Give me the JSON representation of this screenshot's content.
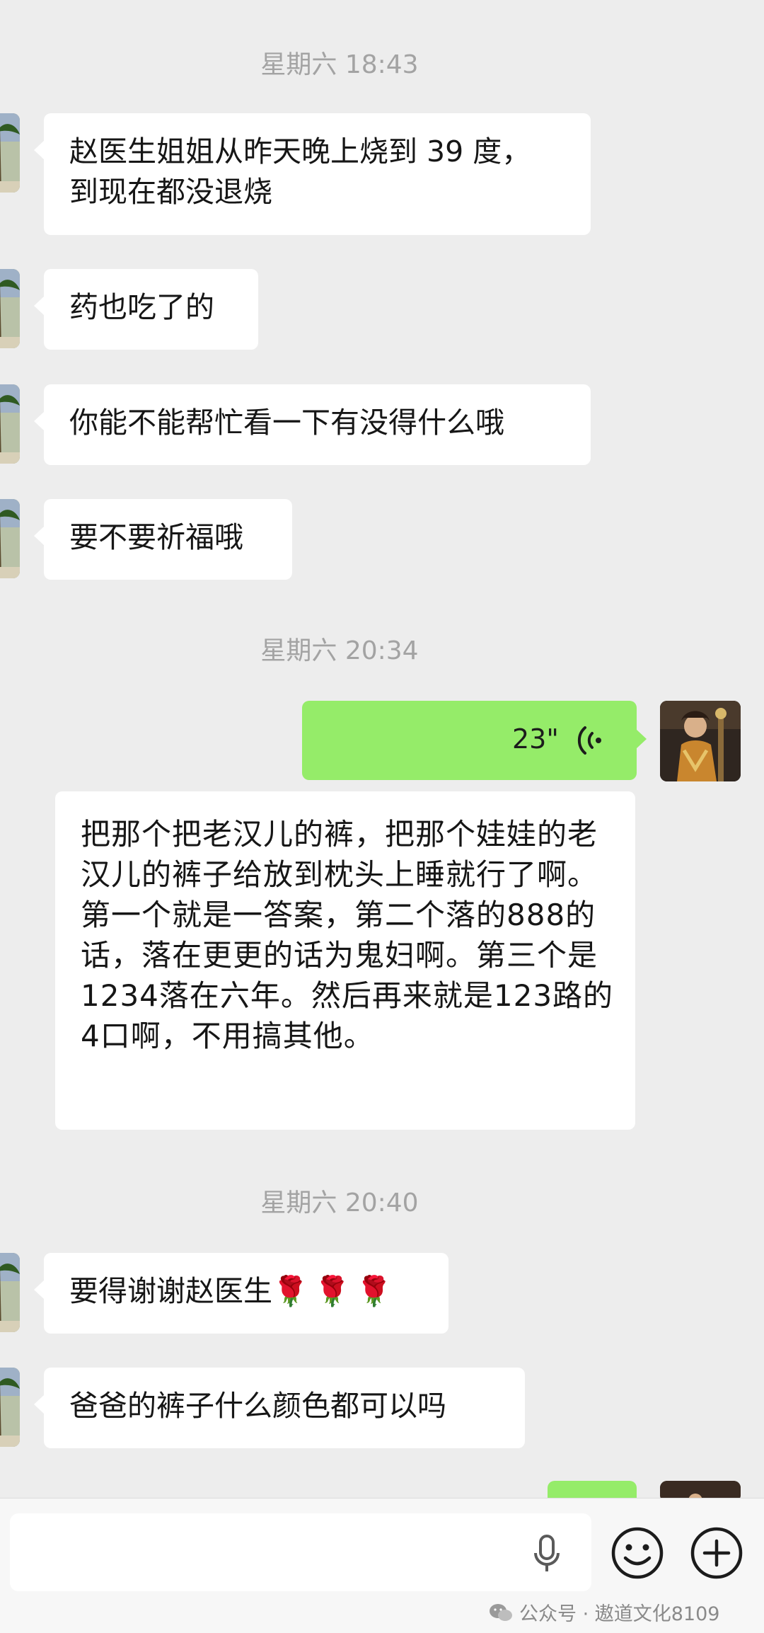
{
  "chat": {
    "timestamps": [
      "星期六 18:43",
      "星期六 20:34",
      "星期六 20:40"
    ],
    "messages_left_1": [
      "赵医生姐姐从昨天晚上烧到 39 度，\n到现在都没退烧",
      "药也吃了的",
      "你能不能帮忙看一下有没得什么哦",
      "要不要祈福哦"
    ],
    "voice": {
      "duration": "23\"",
      "transcript": "把那个把老汉儿的裤，把那个娃娃的老汉儿的裤子给放到枕头上睡就行了啊。第一个就是一答案，第二个落的888的话，落在更更的话为鬼妇啊。第三个是1234落在六年。然后再来就是123路的4口啊，不用搞其他。"
    },
    "messages_left_2": [
      {
        "text": "要得谢谢赵医生",
        "roses": "🌹🌹🌹"
      },
      {
        "text": "爸爸的裤子什么颜色都可以吗"
      }
    ]
  },
  "input_bar": {
    "placeholder": "",
    "mic_icon": "mic-icon",
    "emoji_icon": "emoji-icon",
    "plus_icon": "plus-icon"
  },
  "watermark": {
    "text": "公众号 · 遨道文化8109"
  },
  "colors": {
    "background": "#ededed",
    "self_bubble": "#95ec69",
    "other_bubble": "#ffffff",
    "timestamp": "#a3a3a3"
  }
}
